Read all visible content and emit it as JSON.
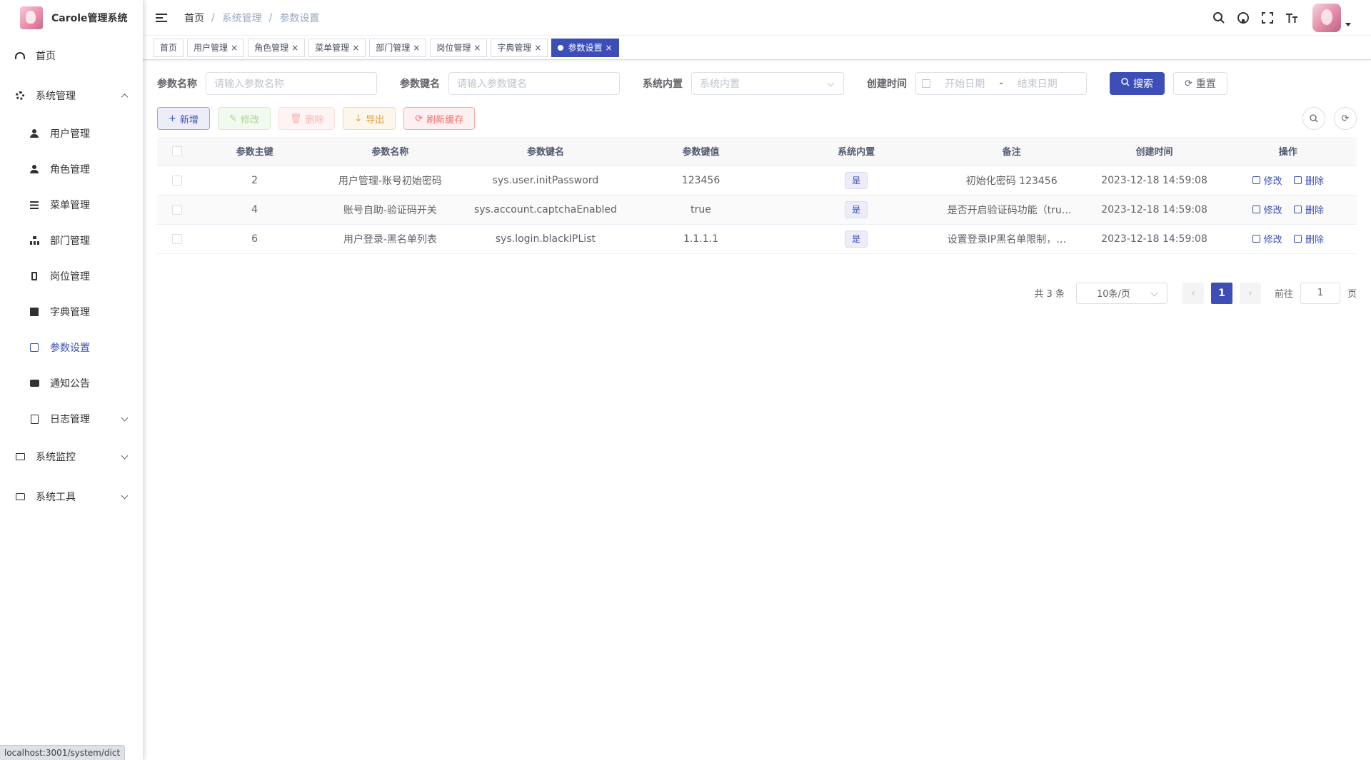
{
  "app": {
    "title": "Carole管理系统"
  },
  "sidebar": {
    "items": [
      {
        "label": "首页",
        "icon": "dashboard-icon"
      },
      {
        "label": "系统管理",
        "icon": "system-icon",
        "expanded": true,
        "children": [
          {
            "label": "用户管理",
            "icon": "user-icon"
          },
          {
            "label": "角色管理",
            "icon": "peoples-icon"
          },
          {
            "label": "菜单管理",
            "icon": "tree-table-icon"
          },
          {
            "label": "部门管理",
            "icon": "tree-icon"
          },
          {
            "label": "岗位管理",
            "icon": "post-icon"
          },
          {
            "label": "字典管理",
            "icon": "dict-icon"
          },
          {
            "label": "参数设置",
            "icon": "edit-icon",
            "active": true
          },
          {
            "label": "通知公告",
            "icon": "message-icon"
          },
          {
            "label": "日志管理",
            "icon": "log-icon"
          }
        ]
      },
      {
        "label": "系统监控",
        "icon": "monitor-icon"
      },
      {
        "label": "系统工具",
        "icon": "tool-icon"
      }
    ]
  },
  "breadcrumb": [
    "首页",
    "系统管理",
    "参数设置"
  ],
  "header_icons": [
    "search-icon",
    "github-icon",
    "fullscreen-icon",
    "font-size-icon"
  ],
  "tags": [
    {
      "label": "首页",
      "closable": false
    },
    {
      "label": "用户管理",
      "closable": true
    },
    {
      "label": "角色管理",
      "closable": true
    },
    {
      "label": "菜单管理",
      "closable": true
    },
    {
      "label": "部门管理",
      "closable": true
    },
    {
      "label": "岗位管理",
      "closable": true
    },
    {
      "label": "字典管理",
      "closable": true
    },
    {
      "label": "参数设置",
      "closable": true,
      "active": true
    }
  ],
  "search": {
    "config_name_label": "参数名称",
    "config_name_placeholder": "请输入参数名称",
    "config_key_label": "参数键名",
    "config_key_placeholder": "请输入参数键名",
    "config_type_label": "系统内置",
    "config_type_placeholder": "系统内置",
    "create_time_label": "创建时间",
    "start_placeholder": "开始日期",
    "range_separator": "-",
    "end_placeholder": "结束日期",
    "search_button": "搜索",
    "reset_button": "重置"
  },
  "toolbar": {
    "add": "新增",
    "edit": "修改",
    "delete": "删除",
    "export": "导出",
    "refresh_cache": "刷新缓存"
  },
  "table": {
    "columns": [
      "参数主键",
      "参数名称",
      "参数键名",
      "参数键值",
      "系统内置",
      "备注",
      "创建时间",
      "操作"
    ],
    "rows": [
      {
        "id": "2",
        "name": "用户管理-账号初始密码",
        "key": "sys.user.initPassword",
        "value": "123456",
        "builtin": "是",
        "remark": "初始化密码 123456",
        "created": "2023-12-18 14:59:08"
      },
      {
        "id": "4",
        "name": "账号自助-验证码开关",
        "key": "sys.account.captchaEnabled",
        "value": "true",
        "builtin": "是",
        "remark": "是否开启验证码功能（true…",
        "created": "2023-12-18 14:59:08"
      },
      {
        "id": "6",
        "name": "用户登录-黑名单列表",
        "key": "sys.login.blackIPList",
        "value": "1.1.1.1",
        "builtin": "是",
        "remark": "设置登录IP黑名单限制，多…",
        "created": "2023-12-18 14:59:08"
      }
    ],
    "op_edit": "修改",
    "op_delete": "删除"
  },
  "pagination": {
    "total_text": "共 3 条",
    "page_size": "10条/页",
    "current_page": "1",
    "goto_label": "前往",
    "goto_value": "1",
    "page_suffix": "页"
  },
  "status_bar_url": "localhost:3001/system/dict",
  "colors": {
    "primary": "#3d4fb7",
    "success_light": "#aad68e",
    "danger": "#f56c6c",
    "warning": "#e6a23c"
  }
}
